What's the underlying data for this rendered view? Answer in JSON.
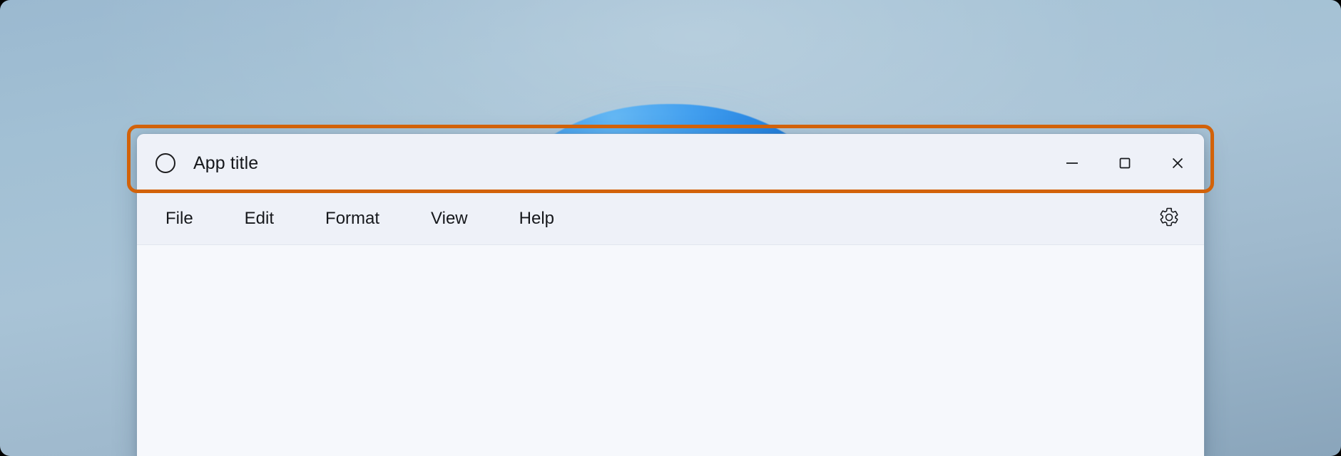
{
  "window": {
    "title": "App title",
    "app_icon": "circle-icon",
    "controls": [
      {
        "name": "minimize",
        "glyph": "minimize-icon",
        "label": "Minimize"
      },
      {
        "name": "maximize",
        "glyph": "maximize-icon",
        "label": "Maximize"
      },
      {
        "name": "close",
        "glyph": "close-icon",
        "label": "Close"
      }
    ]
  },
  "menu_bar": {
    "items": [
      {
        "label": "File"
      },
      {
        "label": "Edit"
      },
      {
        "label": "Format"
      },
      {
        "label": "View"
      },
      {
        "label": "Help"
      }
    ],
    "settings_icon": "gear-icon"
  },
  "content": {
    "text": ""
  },
  "annotation": {
    "type": "highlight-rectangle",
    "target": "title-bar",
    "color": "#d2620a"
  },
  "colors": {
    "titlebar_bg": "#eef1f8",
    "menubar_bg": "#eef1f8",
    "content_bg": "#f6f8fc",
    "text": "#16181c",
    "highlight": "#d2620a",
    "wallpaper_top": "#9bb9d0",
    "wallpaper_bottom": "#8aa5bb",
    "bloom_blue": "#1f7fe0"
  }
}
